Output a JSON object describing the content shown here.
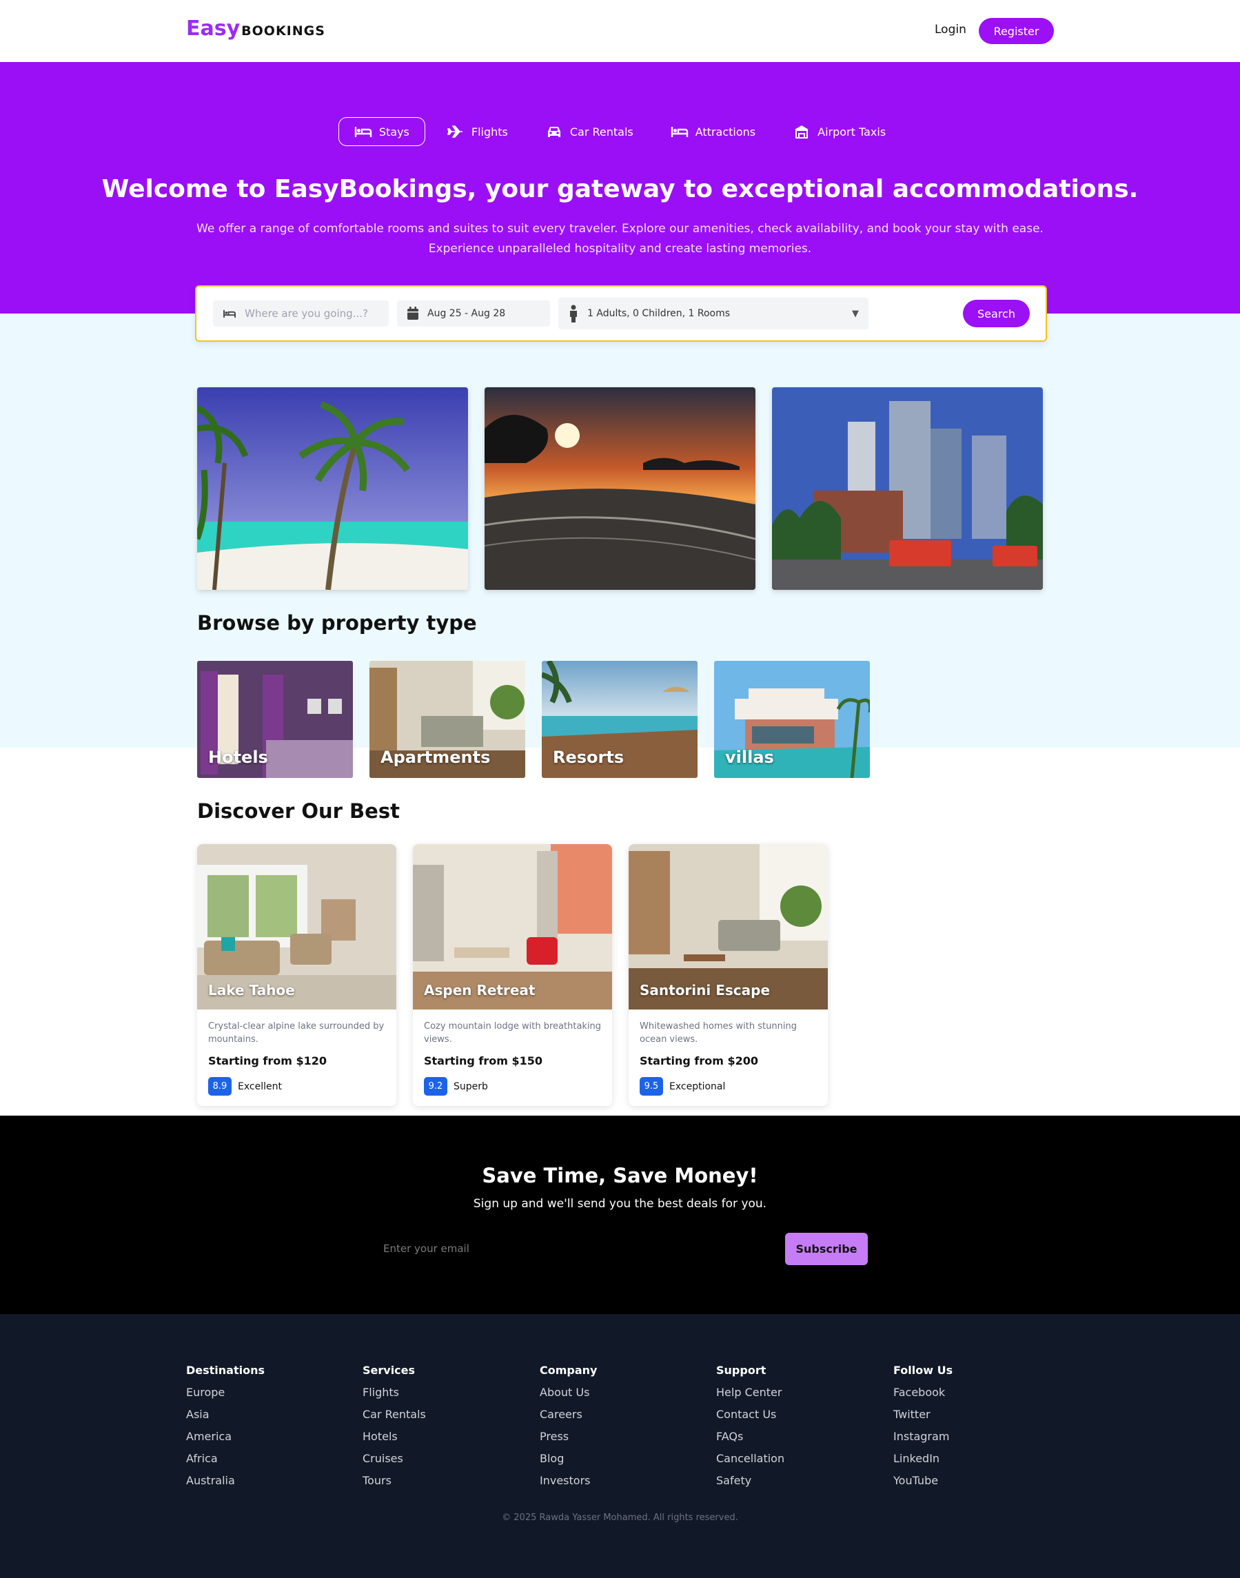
{
  "header": {
    "logo_easy": "Easy",
    "logo_bookings": "BOOKINGS",
    "login_label": "Login",
    "register_label": "Register"
  },
  "nav": {
    "tabs": [
      {
        "label": "Stays",
        "icon": "bed-icon",
        "active": true
      },
      {
        "label": "Flights",
        "icon": "plane-icon",
        "active": false
      },
      {
        "label": "Car Rentals",
        "icon": "car-icon",
        "active": false
      },
      {
        "label": "Attractions",
        "icon": "bed-icon",
        "active": false
      },
      {
        "label": "Airport Taxis",
        "icon": "taxi-icon",
        "active": false
      }
    ]
  },
  "hero": {
    "title": "Welcome to EasyBookings, your gateway to exceptional accommodations.",
    "subtitle": "We offer a range of comfortable rooms and suites to suit every traveler. Explore our amenities, check availability, and book your stay with ease. Experience unparalleled hospitality and create lasting memories."
  },
  "search": {
    "destination_placeholder": "Where are you going...?",
    "dates": "Aug 25 - Aug 28",
    "guests": "1 Adults, 0 Children, 1 Rooms",
    "button_label": "Search"
  },
  "property_section": {
    "title": "Browse by property type",
    "types": [
      {
        "label": "Hotels"
      },
      {
        "label": "Apartments"
      },
      {
        "label": "Resorts"
      },
      {
        "label": "villas"
      }
    ]
  },
  "discover": {
    "title": "Discover Our Best",
    "cards": [
      {
        "name": "Lake Tahoe",
        "description": "Crystal-clear alpine lake surrounded by mountains.",
        "price": "Starting from $120",
        "score": "8.9",
        "rating": "Excellent"
      },
      {
        "name": "Aspen Retreat",
        "description": "Cozy mountain lodge with breathtaking views.",
        "price": "Starting from $150",
        "score": "9.2",
        "rating": "Superb"
      },
      {
        "name": "Santorini Escape",
        "description": "Whitewashed homes with stunning ocean views.",
        "price": "Starting from $200",
        "score": "9.5",
        "rating": "Exceptional"
      }
    ]
  },
  "newsletter": {
    "title": "Save Time, Save Money!",
    "subtitle": "Sign up and we'll send you the best deals for you.",
    "email_placeholder": "Enter your email",
    "button_label": "Subscribe"
  },
  "footer": {
    "columns": [
      {
        "title": "Destinations",
        "links": [
          "Europe",
          "Asia",
          "America",
          "Africa",
          "Australia"
        ]
      },
      {
        "title": "Services",
        "links": [
          "Flights",
          "Car Rentals",
          "Hotels",
          "Cruises",
          "Tours"
        ]
      },
      {
        "title": "Company",
        "links": [
          "About Us",
          "Careers",
          "Press",
          "Blog",
          "Investors"
        ]
      },
      {
        "title": "Support",
        "links": [
          "Help Center",
          "Contact Us",
          "FAQs",
          "Cancellation",
          "Safety"
        ]
      },
      {
        "title": "Follow Us",
        "links": [
          "Facebook",
          "Twitter",
          "Instagram",
          "LinkedIn",
          "YouTube"
        ]
      }
    ],
    "copyright": "© 2025 Rawda Yasser Mohamed. All rights reserved."
  },
  "colors": {
    "brand_purple": "#9b10f5",
    "hero_bg": "#9b0ff7",
    "light_band": "#ecfaff",
    "search_border": "#f3c417",
    "score_blue": "#1d63e8",
    "subscribe_bg": "#c57cf5",
    "footer_bg": "#111827"
  }
}
